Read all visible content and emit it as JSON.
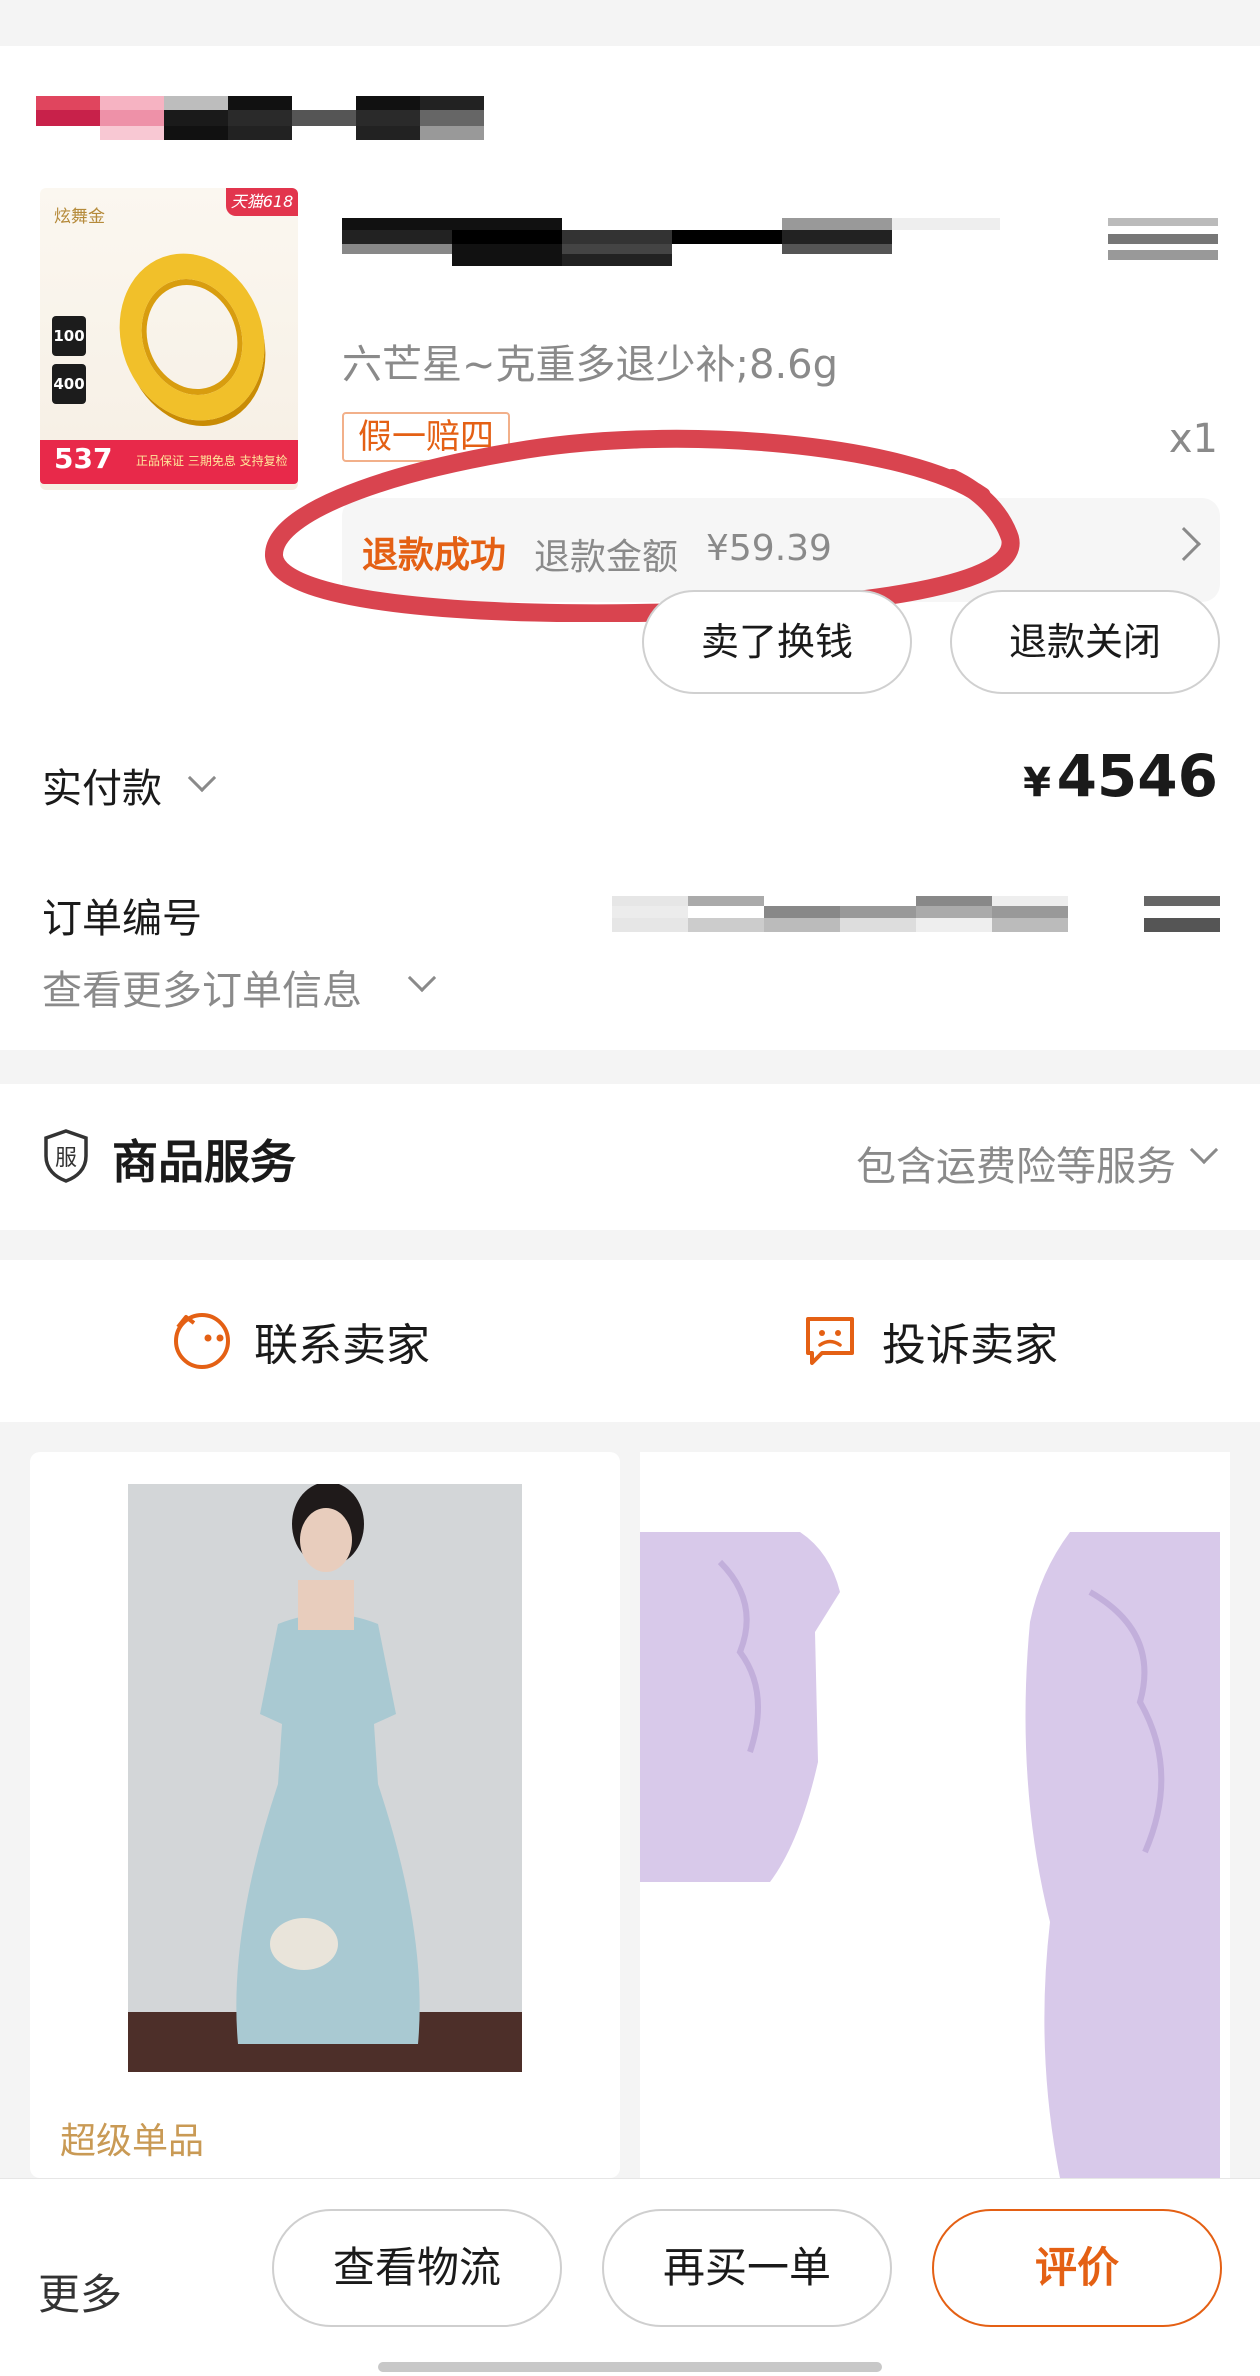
{
  "order": {
    "product": {
      "image_brand_text": "炫舞金",
      "image_promo_tag": "天猫618",
      "image_badge_1": "100",
      "image_badge_2": "400",
      "image_price": "537",
      "image_tip": "正品保证 三期免息 支持复检",
      "spec": "六芒星~克重多退少补;8.6g",
      "guarantee_tag": "假一赔四",
      "quantity": "x1"
    },
    "refund": {
      "status": "退款成功",
      "amount_label": "退款金额",
      "amount_value": "¥59.39"
    },
    "actions": {
      "sell_button": "卖了换钱",
      "refund_close_button": "退款关闭"
    },
    "payment": {
      "label": "实付款",
      "currency": "¥",
      "amount": "4546"
    },
    "order_number_label": "订单编号",
    "more_info": "查看更多订单信息"
  },
  "service": {
    "icon_char": "服",
    "title": "商品服务",
    "summary": "包含运费险等服务"
  },
  "contact": {
    "contact_seller": "联系卖家",
    "complain_seller": "投诉卖家"
  },
  "recommendations": {
    "left_label": "超级单品"
  },
  "bottom_bar": {
    "more": "更多",
    "logistics": "查看物流",
    "rebuy": "再买一单",
    "review": "评价"
  },
  "colors": {
    "accent_orange": "#e46014",
    "annotation_red": "#d9444f",
    "muted_text": "#8a8a8a",
    "background": "#f4f4f4"
  }
}
